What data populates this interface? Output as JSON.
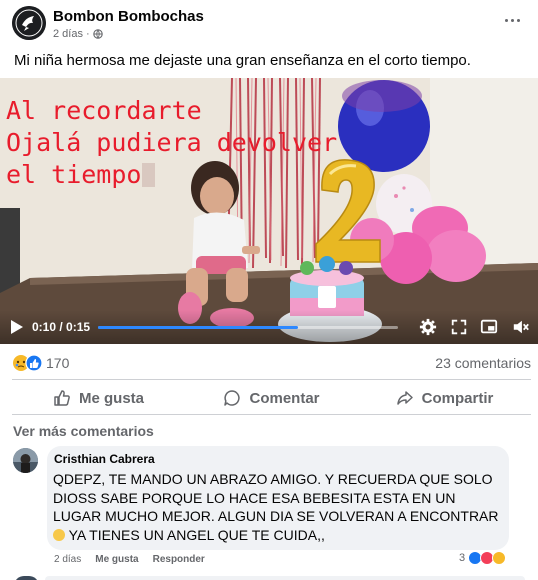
{
  "post": {
    "author": "Bombon Bombochas",
    "time": "2 días",
    "privacy_icon": "globe-icon",
    "text": "Mi niña hermosa me dejaste una gran enseñanza en el corto tiempo."
  },
  "video": {
    "overlay_line1": "Al recordarte",
    "overlay_line2": "Ojalá pudiera devolver",
    "overlay_line3": "el tiempo",
    "time_display": "0:10 / 0:15",
    "progress": 0.667,
    "overlay_color": "#e81c2c",
    "progress_color": "#2d88ff"
  },
  "stats": {
    "reactions_count": "170",
    "comments_count": "23 comentarios"
  },
  "actions": {
    "like": "Me gusta",
    "comment": "Comentar",
    "share": "Compartir"
  },
  "comments": {
    "see_more": "Ver más comentarios",
    "items": [
      {
        "author": "Cristhian Cabrera",
        "text_part1": "QDEPZ, TE MANDO UN ABRAZO AMIGO. Y RECUERDA QUE SOLO DIOSS SABE PORQUE LO HACE ESA BEBESITA ESTA EN UN LUGAR MUCHO MEJOR. ALGUN DIA SE VOLVERAN A ENCONTRAR ",
        "text_part2": " YA TIENES UN ANGEL QUE TE CUIDA,,",
        "time": "2 días",
        "like_label": "Me gusta",
        "reply_label": "Responder",
        "reaction_count": "3"
      }
    ]
  }
}
